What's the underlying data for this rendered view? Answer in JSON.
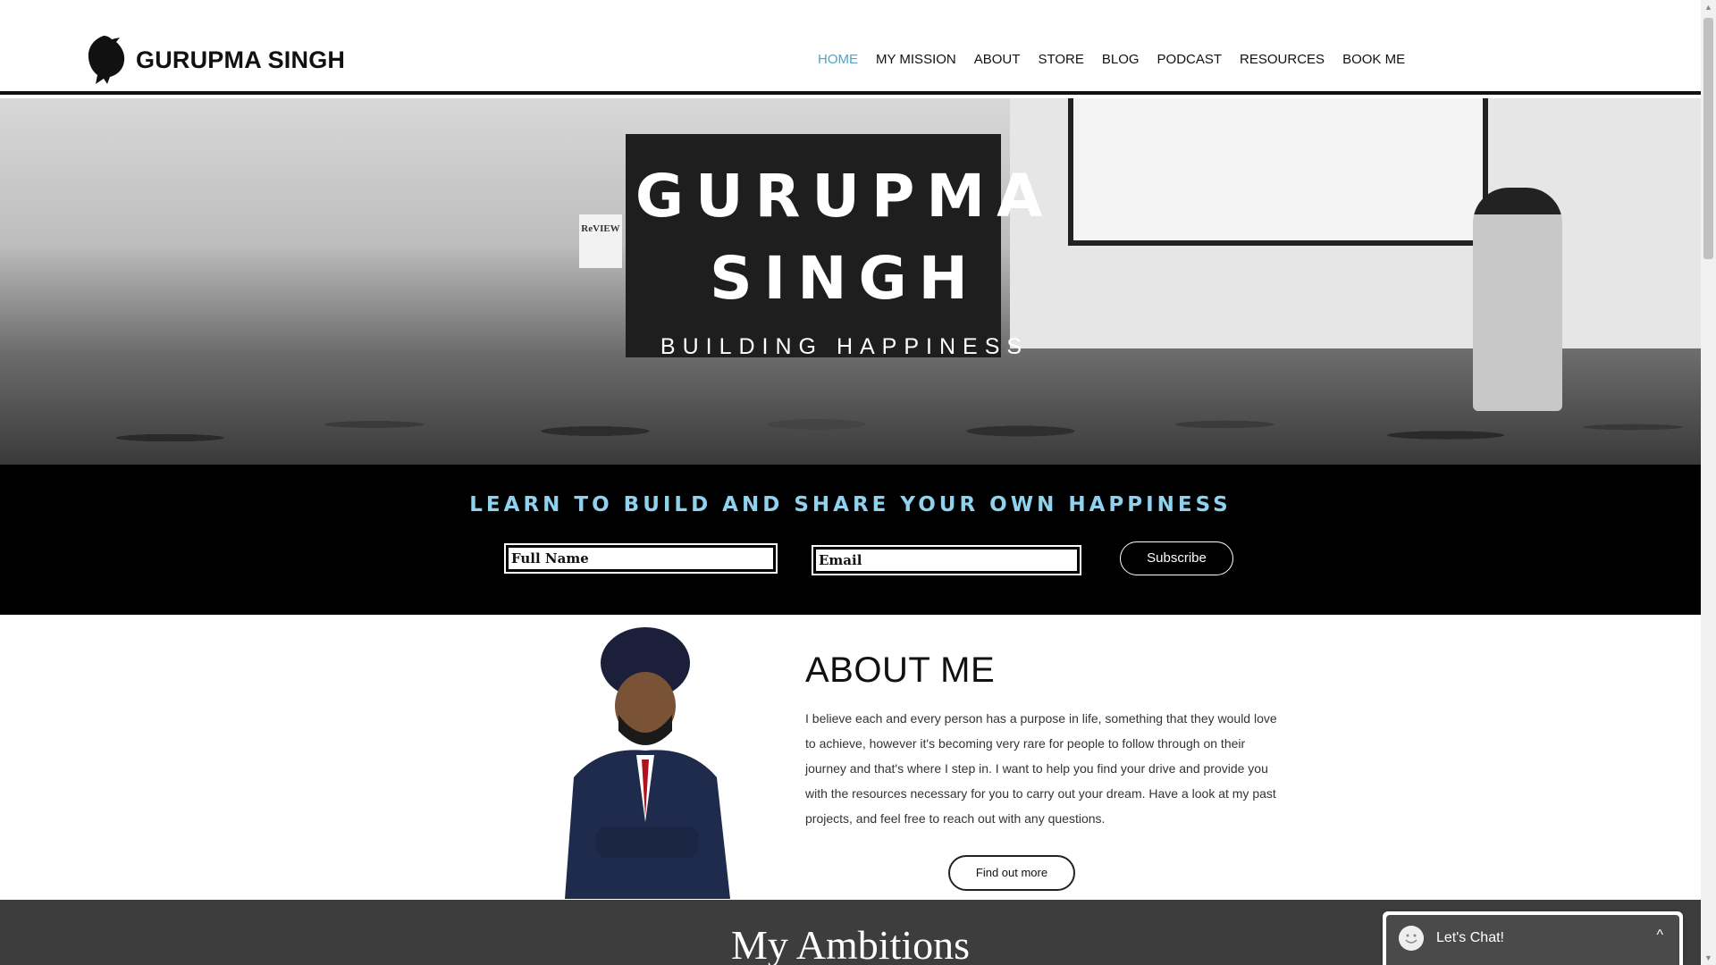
{
  "site": {
    "logo_text": "GURUPMA SINGH",
    "logo_icon": "lion-icon"
  },
  "nav": {
    "items": [
      "HOME",
      "MY MISSION",
      "ABOUT",
      "STORE",
      "BLOG",
      "PODCAST",
      "RESOURCES",
      "BOOK ME"
    ],
    "active": "HOME",
    "active_color": "#4fa4c7"
  },
  "hero": {
    "title_line1": "GURUPMA",
    "title_line2": "SINGH",
    "subtitle": "BUILDING HAPPINESS",
    "sign_text": "ReVIEW"
  },
  "subscribe": {
    "title": "LEARN TO BUILD AND SHARE YOUR OWN HAPPINESS",
    "title_color": "#8fd2ef",
    "name_placeholder": "Full Name",
    "email_placeholder": "Email",
    "button_label": "Subscribe"
  },
  "about": {
    "title": "ABOUT ME",
    "text": "I believe each and every person has a purpose in life, something that they would love to achieve, however it's becoming very rare for people to follow through on their journey and that's where I step in. I want to help you find your drive and provide you with the resources necessary for you to carry out your dream. Have a look at my past projects, and feel free to reach out with any questions.",
    "button_label": "Find out more"
  },
  "ambitions": {
    "title": "My Ambitions"
  },
  "chat": {
    "label": "Let's Chat!",
    "caret": "^"
  }
}
